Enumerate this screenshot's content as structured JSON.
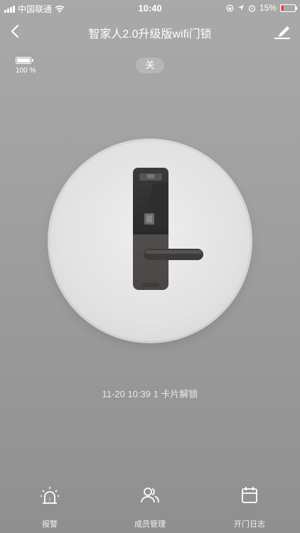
{
  "status_bar": {
    "carrier": "中国联通",
    "time": "10:40",
    "battery_percent": "15%"
  },
  "nav": {
    "title": "智家人2.0升级版wifi门锁",
    "back_icon": "chevron-left-icon",
    "edit_icon": "pencil-icon"
  },
  "lock_battery": {
    "icon": "battery-icon",
    "percent": "100 %"
  },
  "switch_label": "关",
  "last_event": "11-20 10:39  1 卡片解锁",
  "tabs": [
    {
      "label": "报警",
      "icon": "alarm-icon"
    },
    {
      "label": "成员管理",
      "icon": "members-icon"
    },
    {
      "label": "开门日志",
      "icon": "calendar-icon"
    }
  ],
  "colors": {
    "status_battery_low": "#ff3b30",
    "lock_body_top": "#333333",
    "lock_body_bottom": "#555555"
  }
}
